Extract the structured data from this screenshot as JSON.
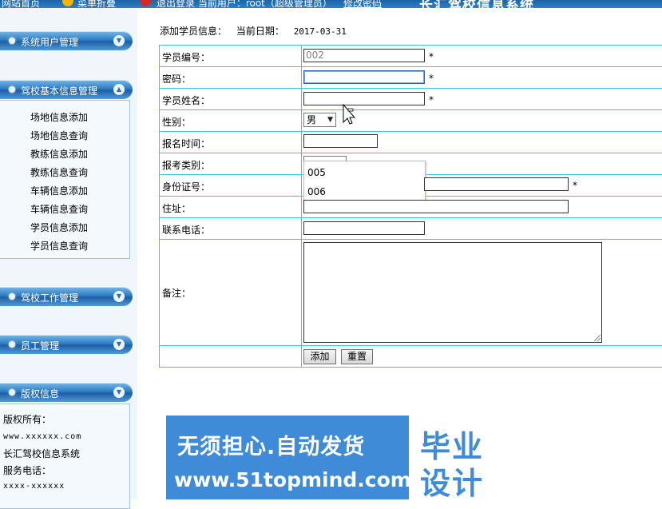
{
  "topbar": {
    "items": [
      "网站首页",
      "菜单折叠",
      "退出登录  当前用户：root（超级管理员）",
      "修改密码"
    ],
    "title": "长汇驾校信息系统"
  },
  "sidebar": {
    "panels": [
      {
        "label": "系统用户管理"
      },
      {
        "label": "驾校基本信息管理",
        "items": [
          "场地信息添加",
          "场地信息查询",
          "教练信息添加",
          "教练信息查询",
          "车辆信息添加",
          "车辆信息查询",
          "学员信息添加",
          "学员信息查询"
        ]
      },
      {
        "label": "驾校工作管理"
      },
      {
        "label": "员工管理"
      },
      {
        "label": "版权信息"
      }
    ],
    "copyright": {
      "owner_label": "版权所有：",
      "website": "www.xxxxxx.com",
      "name": "长汇驾校信息系统",
      "phone_label": "服务电话：",
      "phone": "xxxx-xxxxxx"
    }
  },
  "main": {
    "heading": "添加学员信息：",
    "date_label": "当前日期：",
    "date_value": "2017-03-31",
    "fields": {
      "student_id": {
        "label": "学员编号：",
        "value": "002",
        "required": "*"
      },
      "password": {
        "label": "密码：",
        "value": "",
        "required": "*"
      },
      "name": {
        "label": "学员姓名：",
        "value": "",
        "required": "*"
      },
      "gender": {
        "label": "性别：",
        "value": "男"
      },
      "register_time": {
        "label": "报名时间：",
        "value": ""
      },
      "exam_type": {
        "label": "报考类别：",
        "options": [
          "005",
          "006"
        ]
      },
      "id_number": {
        "label": "身份证号：",
        "value": "",
        "required": "*"
      },
      "address": {
        "label": "住址：",
        "value": ""
      },
      "phone": {
        "label": "联系电话：",
        "value": ""
      },
      "remark": {
        "label": "备注：",
        "value": ""
      }
    },
    "buttons": {
      "add": "添加",
      "reset": "重置"
    }
  },
  "watermark": {
    "line1": "无须担心.自动发货",
    "line2": "www.51topmind.com",
    "tag1": "毕业",
    "tag2": "设计"
  },
  "colors": {
    "grid_border": "#3fc6d4",
    "banner": "#3f8bd8",
    "sidebar_header": "#2f7dc4"
  }
}
